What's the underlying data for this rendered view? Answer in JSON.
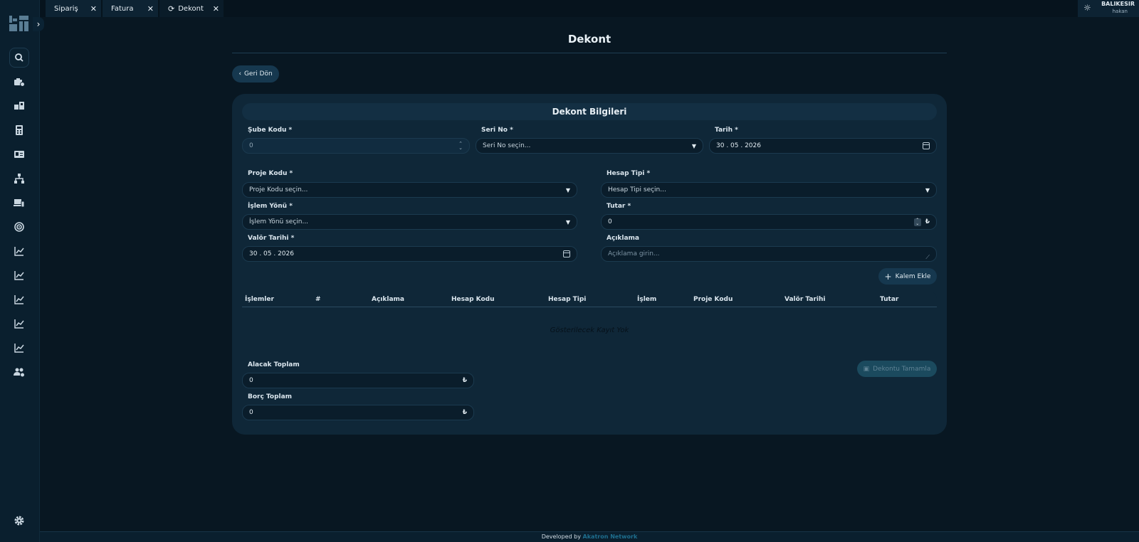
{
  "tabs": [
    {
      "label": "Sipariş",
      "close": "✕"
    },
    {
      "label": "Fatura",
      "close": "✕"
    },
    {
      "label": "Dekont",
      "close": "✕"
    }
  ],
  "user": {
    "branch": "BALIKESIR",
    "username": "hakan"
  },
  "page": {
    "title": "Dekont",
    "back_label": "Geri Dön"
  },
  "form": {
    "header": "Dekont Bilgileri",
    "sube_kodu": {
      "label": "Şube Kodu *",
      "value": "0"
    },
    "seri_no": {
      "label": "Seri No *",
      "placeholder": "Seri No seçin..."
    },
    "tarih": {
      "label": "Tarih *",
      "value": "30 . 05 . 2026"
    },
    "proje_kodu": {
      "label": "Proje Kodu *",
      "placeholder": "Proje Kodu seçin..."
    },
    "hesap_tipi": {
      "label": "Hesap Tipi *",
      "placeholder": "Hesap Tipi seçin..."
    },
    "islem_yonu": {
      "label": "İşlem Yönü *",
      "placeholder": "İşlem Yönü seçin..."
    },
    "tutar": {
      "label": "Tutar *",
      "value": "0"
    },
    "valor_tarihi": {
      "label": "Valör Tarihi *",
      "value": "30 . 05 . 2026"
    },
    "aciklama": {
      "label": "Açıklama",
      "placeholder": "Açıklama girin..."
    },
    "add_item_label": "Kalem Ekle"
  },
  "table": {
    "columns": [
      "İşlemler",
      "#",
      "Açıklama",
      "Hesap Kodu",
      "Hesap Tipi",
      "İşlem",
      "Proje Kodu",
      "Valör Tarihi",
      "Tutar"
    ],
    "empty_text": "Gösterilecek Kayıt Yok"
  },
  "totals": {
    "alacak": {
      "label": "Alacak Toplam",
      "value": "0"
    },
    "borc": {
      "label": "Borç Toplam",
      "value": "0"
    }
  },
  "complete_label": "Dekontu Tamamla",
  "currency_symbol": "₺",
  "footer": {
    "prefix": "Developed by",
    "brand": "Akatron Network"
  },
  "colors": {
    "background": "#081722",
    "card": "#0f2738",
    "accent": "#16384f",
    "brand": "#1e6e8e"
  }
}
